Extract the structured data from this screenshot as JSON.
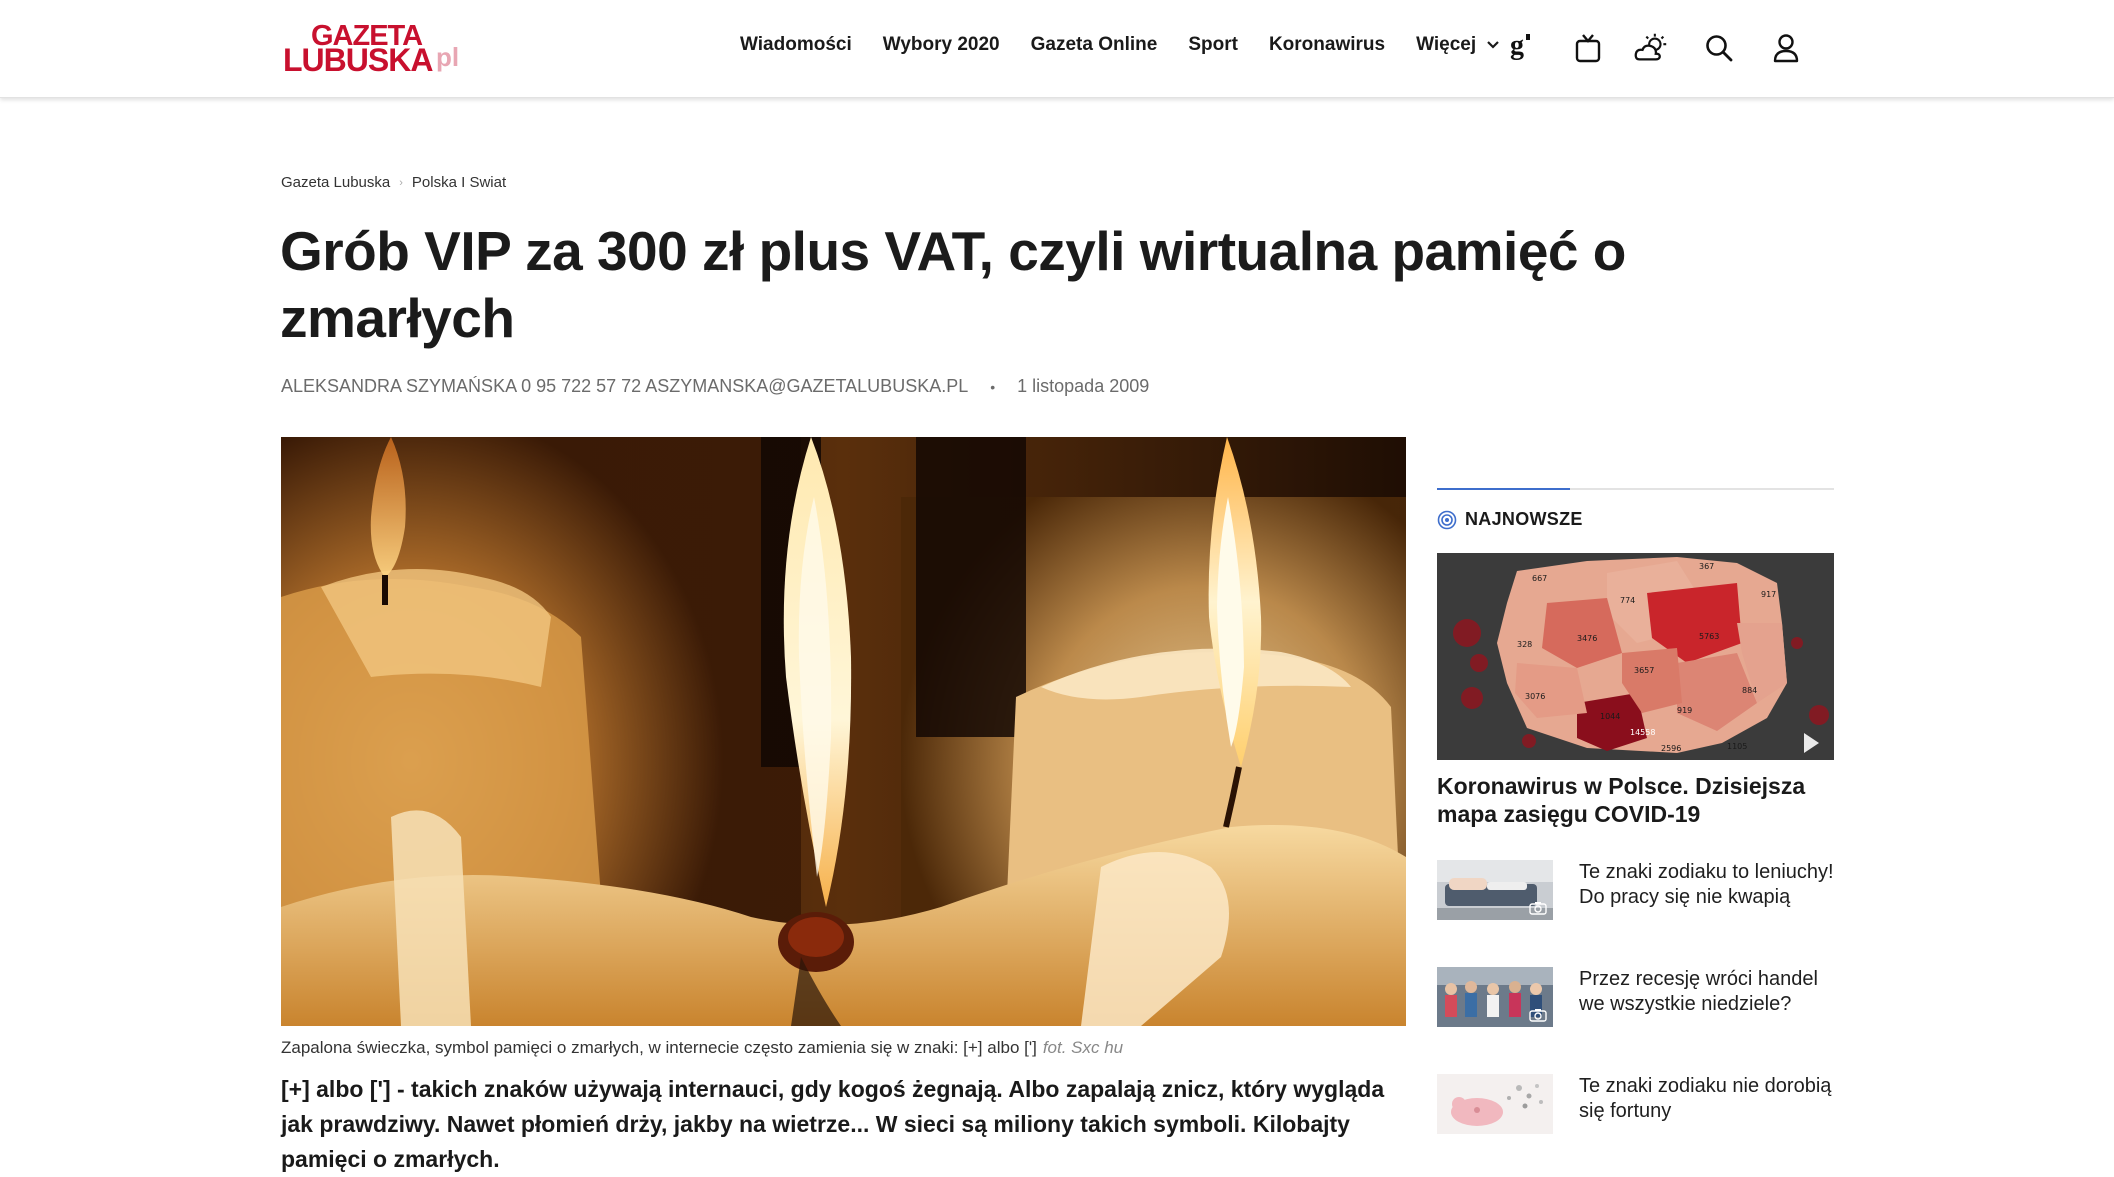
{
  "header": {
    "logo": {
      "line1": "GAZETA",
      "line2": "LUBUSKA",
      "suffix": "pl"
    },
    "nav": [
      "Wiadomości",
      "Wybory 2020",
      "Gazeta Online",
      "Sport",
      "Koronawirus",
      "Więcej"
    ],
    "icons": [
      "g-brand-icon",
      "tv-icon",
      "weather-icon",
      "search-icon",
      "user-icon"
    ]
  },
  "breadcrumb": [
    "Gazeta Lubuska",
    "Polska I Swiat"
  ],
  "article": {
    "title": "Grób VIP za 300 zł plus VAT, czyli wirtualna pamięć o zmarłych",
    "author": "ALEKSANDRA SZYMAŃSKA 0 95 722 57 72 ASZYMANSKA@GAZETALUBUSKA.PL",
    "date": "1 listopada 2009",
    "caption": "Zapalona świeczka, symbol pamięci o zmarłych, w internecie często zamienia się w znaki: [+] albo [']",
    "credit": "fot. Sxc hu",
    "lead": "[+] albo ['] - takich znaków używają internauci, gdy kogoś żegnają. Albo zapalają znicz, który wygląda jak prawdziwy. Nawet płomień drży, jakby na wietrze... W sieci są miliony takich symboli. Kilobajty pamięci o zmarłych."
  },
  "sidebar": {
    "heading": "NAJNOWSZE",
    "featured": {
      "title": "Koronawirus w Polsce. Dzisiejsza mapa zasięgu COVID-19",
      "map_labels": [
        "667",
        "367",
        "917",
        "774",
        "3476",
        "5763",
        "328",
        "3657",
        "3076",
        "1044",
        "884",
        "919",
        "14558",
        "2596",
        "1105"
      ]
    },
    "items": [
      {
        "title": "Te znaki zodiaku to leniuchy! Do pracy się nie kwapią"
      },
      {
        "title": "Przez recesję wróci handel we wszystkie niedziele?"
      },
      {
        "title": "Te znaki zodiaku nie dorobią się fortuny"
      }
    ]
  },
  "colors": {
    "brand": "#c8102e",
    "accent": "#3e6ecc"
  }
}
